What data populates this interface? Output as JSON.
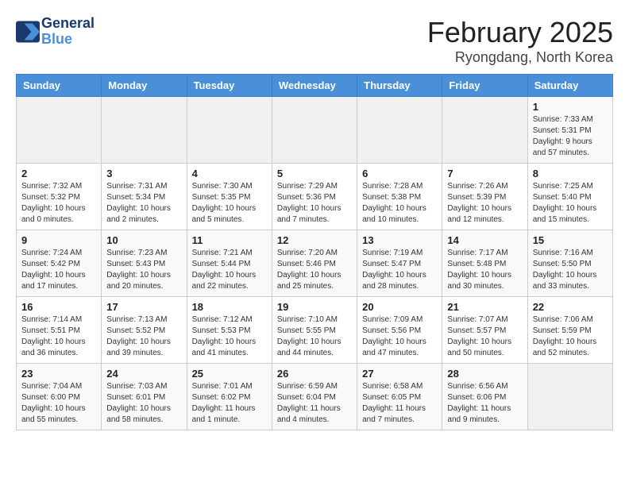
{
  "header": {
    "logo_line1": "General",
    "logo_line2": "Blue",
    "month_year": "February 2025",
    "location": "Ryongdang, North Korea"
  },
  "weekdays": [
    "Sunday",
    "Monday",
    "Tuesday",
    "Wednesday",
    "Thursday",
    "Friday",
    "Saturday"
  ],
  "weeks": [
    [
      {
        "day": "",
        "info": ""
      },
      {
        "day": "",
        "info": ""
      },
      {
        "day": "",
        "info": ""
      },
      {
        "day": "",
        "info": ""
      },
      {
        "day": "",
        "info": ""
      },
      {
        "day": "",
        "info": ""
      },
      {
        "day": "1",
        "info": "Sunrise: 7:33 AM\nSunset: 5:31 PM\nDaylight: 9 hours\nand 57 minutes."
      }
    ],
    [
      {
        "day": "2",
        "info": "Sunrise: 7:32 AM\nSunset: 5:32 PM\nDaylight: 10 hours\nand 0 minutes."
      },
      {
        "day": "3",
        "info": "Sunrise: 7:31 AM\nSunset: 5:34 PM\nDaylight: 10 hours\nand 2 minutes."
      },
      {
        "day": "4",
        "info": "Sunrise: 7:30 AM\nSunset: 5:35 PM\nDaylight: 10 hours\nand 5 minutes."
      },
      {
        "day": "5",
        "info": "Sunrise: 7:29 AM\nSunset: 5:36 PM\nDaylight: 10 hours\nand 7 minutes."
      },
      {
        "day": "6",
        "info": "Sunrise: 7:28 AM\nSunset: 5:38 PM\nDaylight: 10 hours\nand 10 minutes."
      },
      {
        "day": "7",
        "info": "Sunrise: 7:26 AM\nSunset: 5:39 PM\nDaylight: 10 hours\nand 12 minutes."
      },
      {
        "day": "8",
        "info": "Sunrise: 7:25 AM\nSunset: 5:40 PM\nDaylight: 10 hours\nand 15 minutes."
      }
    ],
    [
      {
        "day": "9",
        "info": "Sunrise: 7:24 AM\nSunset: 5:42 PM\nDaylight: 10 hours\nand 17 minutes."
      },
      {
        "day": "10",
        "info": "Sunrise: 7:23 AM\nSunset: 5:43 PM\nDaylight: 10 hours\nand 20 minutes."
      },
      {
        "day": "11",
        "info": "Sunrise: 7:21 AM\nSunset: 5:44 PM\nDaylight: 10 hours\nand 22 minutes."
      },
      {
        "day": "12",
        "info": "Sunrise: 7:20 AM\nSunset: 5:46 PM\nDaylight: 10 hours\nand 25 minutes."
      },
      {
        "day": "13",
        "info": "Sunrise: 7:19 AM\nSunset: 5:47 PM\nDaylight: 10 hours\nand 28 minutes."
      },
      {
        "day": "14",
        "info": "Sunrise: 7:17 AM\nSunset: 5:48 PM\nDaylight: 10 hours\nand 30 minutes."
      },
      {
        "day": "15",
        "info": "Sunrise: 7:16 AM\nSunset: 5:50 PM\nDaylight: 10 hours\nand 33 minutes."
      }
    ],
    [
      {
        "day": "16",
        "info": "Sunrise: 7:14 AM\nSunset: 5:51 PM\nDaylight: 10 hours\nand 36 minutes."
      },
      {
        "day": "17",
        "info": "Sunrise: 7:13 AM\nSunset: 5:52 PM\nDaylight: 10 hours\nand 39 minutes."
      },
      {
        "day": "18",
        "info": "Sunrise: 7:12 AM\nSunset: 5:53 PM\nDaylight: 10 hours\nand 41 minutes."
      },
      {
        "day": "19",
        "info": "Sunrise: 7:10 AM\nSunset: 5:55 PM\nDaylight: 10 hours\nand 44 minutes."
      },
      {
        "day": "20",
        "info": "Sunrise: 7:09 AM\nSunset: 5:56 PM\nDaylight: 10 hours\nand 47 minutes."
      },
      {
        "day": "21",
        "info": "Sunrise: 7:07 AM\nSunset: 5:57 PM\nDaylight: 10 hours\nand 50 minutes."
      },
      {
        "day": "22",
        "info": "Sunrise: 7:06 AM\nSunset: 5:59 PM\nDaylight: 10 hours\nand 52 minutes."
      }
    ],
    [
      {
        "day": "23",
        "info": "Sunrise: 7:04 AM\nSunset: 6:00 PM\nDaylight: 10 hours\nand 55 minutes."
      },
      {
        "day": "24",
        "info": "Sunrise: 7:03 AM\nSunset: 6:01 PM\nDaylight: 10 hours\nand 58 minutes."
      },
      {
        "day": "25",
        "info": "Sunrise: 7:01 AM\nSunset: 6:02 PM\nDaylight: 11 hours\nand 1 minute."
      },
      {
        "day": "26",
        "info": "Sunrise: 6:59 AM\nSunset: 6:04 PM\nDaylight: 11 hours\nand 4 minutes."
      },
      {
        "day": "27",
        "info": "Sunrise: 6:58 AM\nSunset: 6:05 PM\nDaylight: 11 hours\nand 7 minutes."
      },
      {
        "day": "28",
        "info": "Sunrise: 6:56 AM\nSunset: 6:06 PM\nDaylight: 11 hours\nand 9 minutes."
      },
      {
        "day": "",
        "info": ""
      }
    ]
  ]
}
